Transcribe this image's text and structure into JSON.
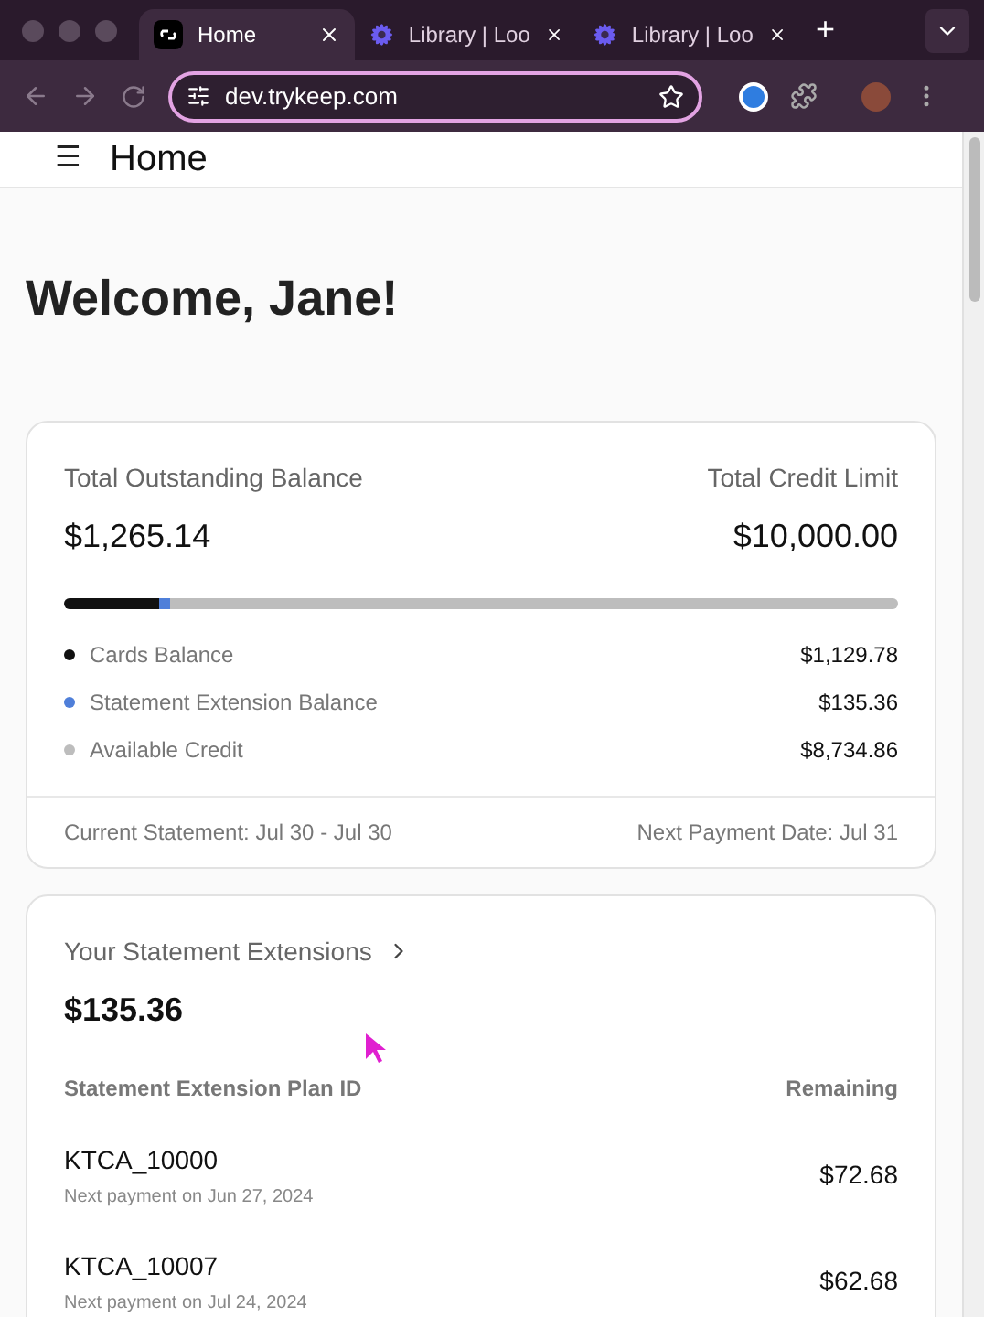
{
  "browser": {
    "tabs": [
      {
        "title": "Home",
        "selected": true,
        "kind": "app"
      },
      {
        "title": "Library | Loo",
        "selected": false,
        "kind": "library"
      },
      {
        "title": "Library | Loo",
        "selected": false,
        "kind": "library"
      }
    ],
    "new_tab": "+",
    "address": "dev.trykeep.com"
  },
  "header": {
    "menu": "☰",
    "title": "Home"
  },
  "greeting": "Welcome, Jane!",
  "balance_card": {
    "left_label": "Total Outstanding Balance",
    "left_value": "$1,265.14",
    "right_label": "Total Credit Limit",
    "right_value": "$10,000.00",
    "items": [
      {
        "label": "Cards Balance",
        "value": "$1,129.78",
        "color": "#111111",
        "level": 0.113
      },
      {
        "label": "Statement Extension Balance",
        "value": "$135.36",
        "color": "#4f7fd9",
        "level": 0.0135
      },
      {
        "label": "Available Credit",
        "value": "$8,734.86",
        "color": "#bdbdbd",
        "level": 0.8735
      }
    ],
    "footer_left": "Current Statement: Jul 30 - Jul 30",
    "footer_right": "Next Payment Date: Jul 31"
  },
  "extensions_card": {
    "title": "Your Statement Extensions",
    "total": "$135.36",
    "columns": [
      "Statement Extension Plan ID",
      "Remaining"
    ],
    "rows": [
      {
        "id": "KTCA_10000",
        "note": "Next payment on Jun 27, 2024",
        "remaining": "$72.68"
      },
      {
        "id": "KTCA_10007",
        "note": "Next payment on Jul 24, 2024",
        "remaining": "$62.68"
      }
    ]
  }
}
